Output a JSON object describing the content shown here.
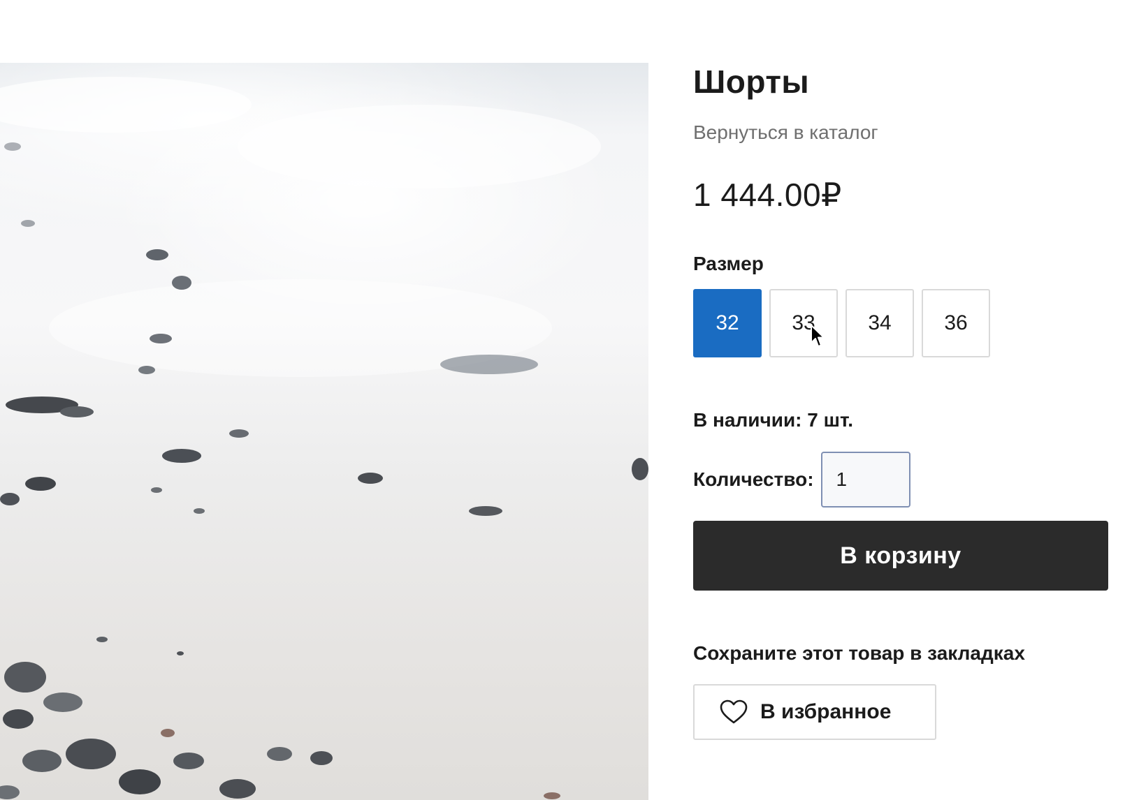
{
  "product": {
    "title": "Шорты",
    "back_link": "Вернуться в каталог",
    "price": "1 444.00₽"
  },
  "size": {
    "label": "Размер",
    "options": [
      "32",
      "33",
      "34",
      "36"
    ],
    "selected": "32"
  },
  "stock": {
    "text": "В наличии: 7 шт."
  },
  "quantity": {
    "label": "Количество:",
    "value": "1"
  },
  "cart": {
    "button_label": "В корзину"
  },
  "bookmarks": {
    "label": "Сохраните этот товар в закладках",
    "favorite_button": "В избранное"
  },
  "colors": {
    "accent": "#1a6cc2",
    "cart_button": "#2b2b2b"
  },
  "icons": {
    "favorite": "heart-icon",
    "cursor": "mouse-pointer-icon"
  }
}
